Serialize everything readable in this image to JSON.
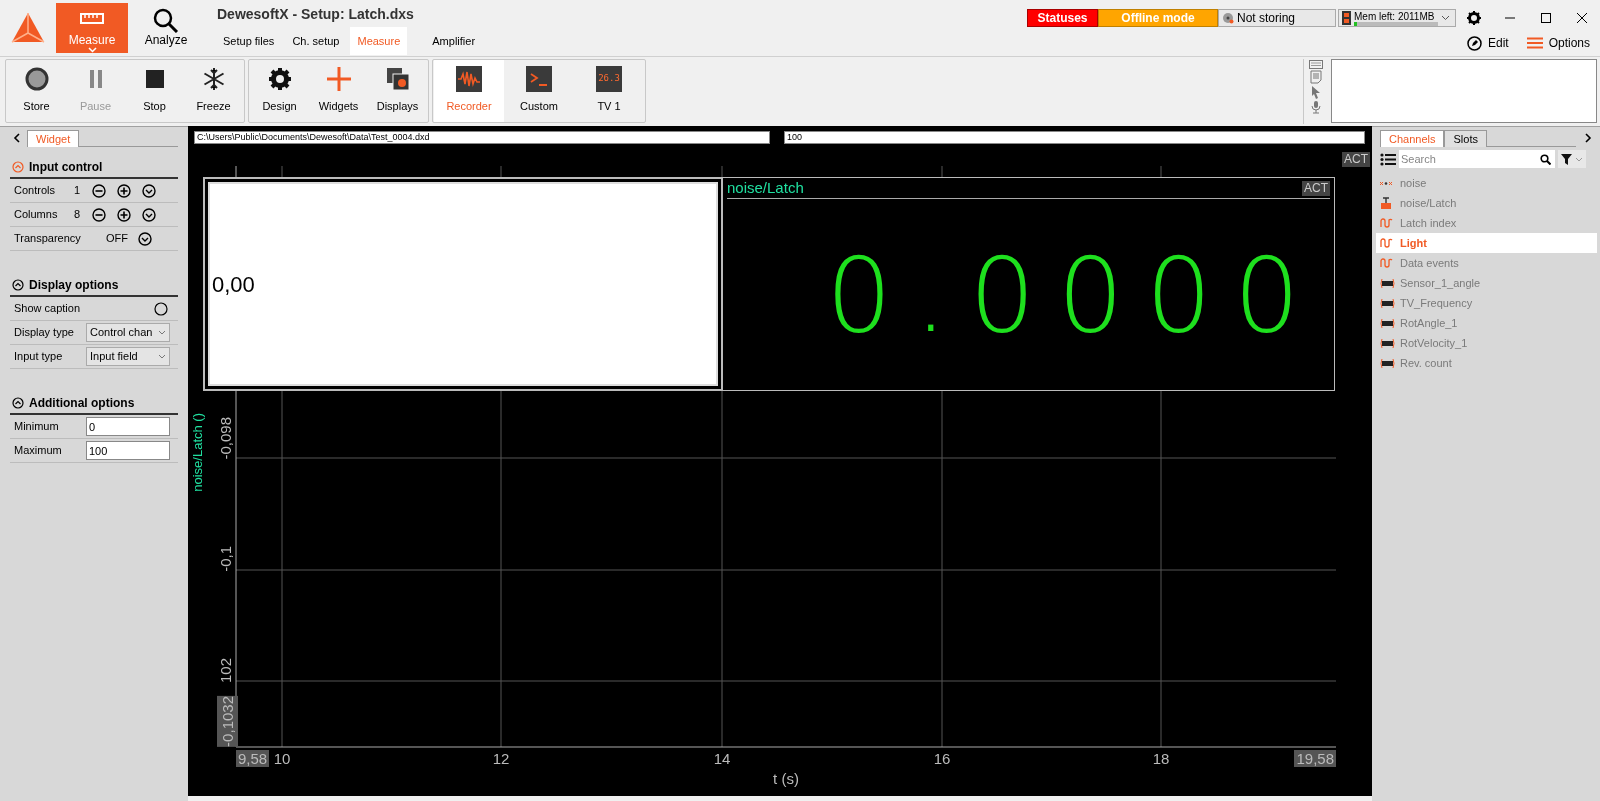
{
  "app": {
    "title": "DewesoftX - Setup: Latch.dxs"
  },
  "modes": [
    {
      "label": "Measure",
      "kind": "ruler",
      "selected": true
    },
    {
      "label": "Analyze",
      "kind": "search",
      "selected": false
    }
  ],
  "tabs": [
    {
      "label": "Setup files",
      "selected": false
    },
    {
      "label": "Ch. setup",
      "selected": false
    },
    {
      "label": "Measure",
      "selected": true
    },
    {
      "label": "Amplifier",
      "selected": false
    }
  ],
  "status": {
    "statuses": "Statuses",
    "mode": "Offline mode",
    "storing": "Not storing",
    "memory": "Mem left: 2011MB",
    "memory_level": {
      "level": 0.03
    }
  },
  "top_actions": [
    {
      "label": "Edit",
      "kind": "pencil"
    },
    {
      "label": "Options",
      "kind": "menu"
    }
  ],
  "toolbar": [
    {
      "items": [
        {
          "label": "Store",
          "kind": "record",
          "disabled": false,
          "selected": false
        },
        {
          "label": "Pause",
          "kind": "pause",
          "disabled": true,
          "selected": false
        },
        {
          "label": "Stop",
          "kind": "stop",
          "disabled": false,
          "selected": false
        },
        {
          "label": "Freeze",
          "kind": "snowflake",
          "disabled": false,
          "selected": false
        }
      ]
    },
    {
      "items": [
        {
          "label": "Design",
          "kind": "gear",
          "disabled": false,
          "selected": false
        },
        {
          "label": "Widgets",
          "kind": "plus",
          "disabled": false,
          "selected": false
        },
        {
          "label": "Displays",
          "kind": "displays",
          "disabled": false,
          "selected": false
        }
      ]
    },
    {
      "items": [
        {
          "label": "Recorder",
          "kind": "recorder",
          "disabled": false,
          "selected": true
        },
        {
          "label": "Custom",
          "kind": "terminal",
          "disabled": false,
          "selected": false
        },
        {
          "label": "TV 1",
          "kind": "digital",
          "display_text": "26.3",
          "disabled": false,
          "selected": false
        }
      ]
    }
  ],
  "widget_panel": {
    "tab": "Widget",
    "sections": [
      {
        "title": "Input control",
        "active": true,
        "rows": [
          {
            "kind": "stepper",
            "label": "Controls",
            "value": "1"
          },
          {
            "kind": "stepper",
            "label": "Columns",
            "value": "8"
          },
          {
            "kind": "toggle",
            "label": "Transparency",
            "value": "OFF"
          }
        ]
      },
      {
        "title": "Display options",
        "active": false,
        "rows": [
          {
            "kind": "radio",
            "label": "Show caption",
            "checked": false
          },
          {
            "kind": "select",
            "label": "Display type",
            "value": "Control chan"
          },
          {
            "kind": "select",
            "label": "Input type",
            "value": "Input field"
          }
        ]
      },
      {
        "title": "Additional options",
        "active": false,
        "rows": [
          {
            "kind": "input",
            "label": "Minimum",
            "value": "0"
          },
          {
            "kind": "input",
            "label": "Maximum",
            "value": "100"
          }
        ]
      }
    ]
  },
  "display": {
    "file_path": "C:\\Users\\Public\\Documents\\Dewesoft\\Data\\Test_0004.dxd",
    "field_2": "100",
    "act": "ACT",
    "input_widget": {
      "value": "0,00"
    },
    "meter": {
      "caption": "noise/Latch",
      "act": "ACT",
      "value": "0.0000"
    },
    "plot": {
      "ylabel": "noise/Latch ()",
      "yticks": [
        "-0,098",
        "-0,1",
        "102"
      ],
      "ymin": "-0,1032",
      "xticks": [
        "10",
        "12",
        "14",
        "16",
        "18"
      ],
      "xmin": "9,58",
      "xmax": "19,58",
      "xlabel": "t (s)"
    }
  },
  "channels_panel": {
    "tabs": [
      {
        "label": "Channels",
        "selected": true
      },
      {
        "label": "Slots",
        "selected": false
      }
    ],
    "search": {
      "placeholder": "Search"
    },
    "channels": [
      {
        "name": "noise",
        "kind": "math",
        "selected": false
      },
      {
        "name": "noise/Latch",
        "kind": "latch",
        "selected": false
      },
      {
        "name": "Latch index",
        "kind": "wave",
        "selected": false
      },
      {
        "name": "Light",
        "kind": "wave",
        "selected": true
      },
      {
        "name": "Data events",
        "kind": "wave",
        "selected": false
      },
      {
        "name": "Sensor_1_angle",
        "kind": "counter",
        "selected": false
      },
      {
        "name": "TV_Frequency",
        "kind": "counter",
        "selected": false
      },
      {
        "name": "RotAngle_1",
        "kind": "counter",
        "selected": false
      },
      {
        "name": "RotVelocity_1",
        "kind": "counter",
        "selected": false
      },
      {
        "name": "Rev. count",
        "kind": "counter",
        "selected": false
      }
    ]
  }
}
